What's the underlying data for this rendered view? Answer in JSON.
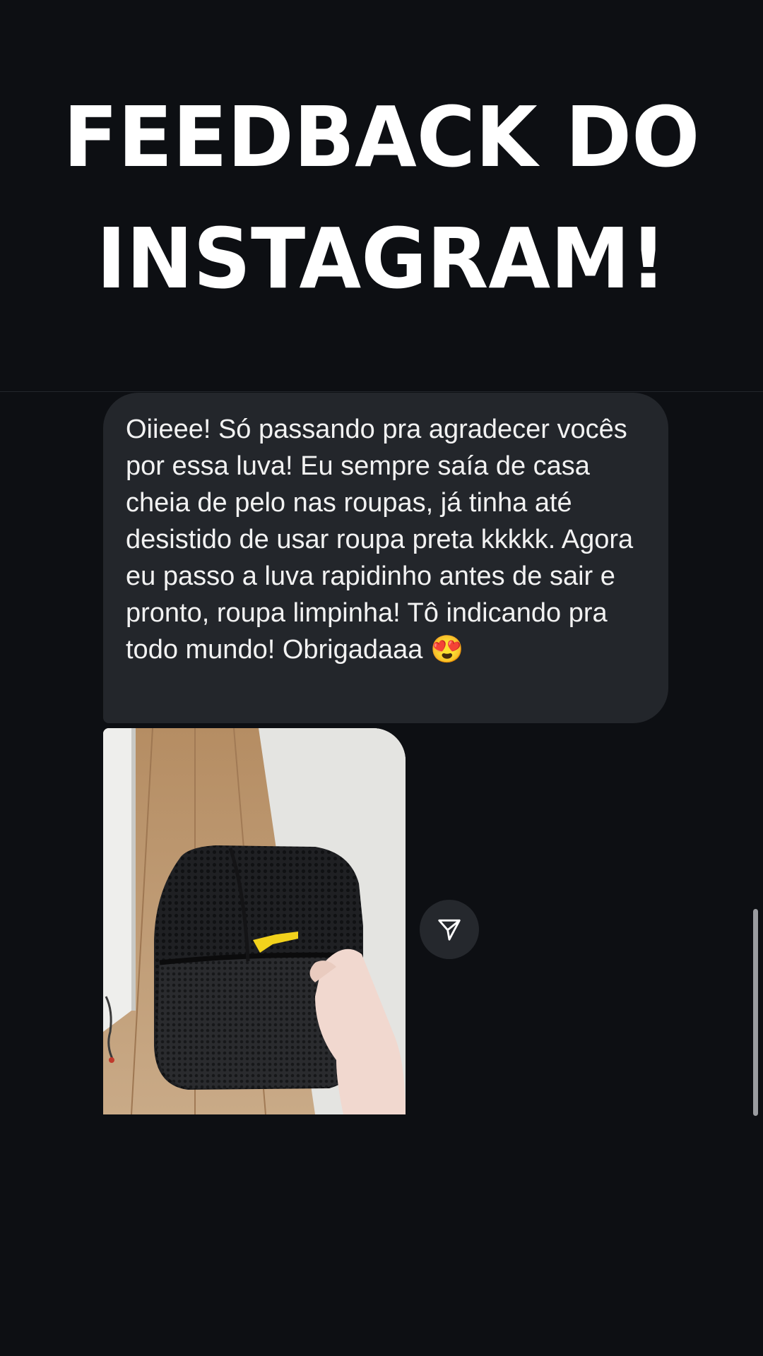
{
  "header": {
    "title_line1": "FEEDBACK DO",
    "title_line2": "INSTAGRAM!"
  },
  "message": {
    "text": "Oiieee! Só passando pra agradecer vocês por essa luva! Eu sempre saía de casa cheia de pelo nas roupas, já tinha até desistido de usar roupa preta kkkkk. Agora eu passo a luva rapidinho antes de sair e pronto, roupa limpinha! Tô indicando pra todo mundo! Obrigadaaa 😍",
    "bubble_color": "#23262b",
    "text_color": "#f2f2f2"
  },
  "photo": {
    "subject": "black mesh pet hair removal glove held in hand"
  },
  "share_button": {
    "icon": "send-icon"
  },
  "colors": {
    "background": "#0d0f13",
    "title": "#ffffff"
  }
}
